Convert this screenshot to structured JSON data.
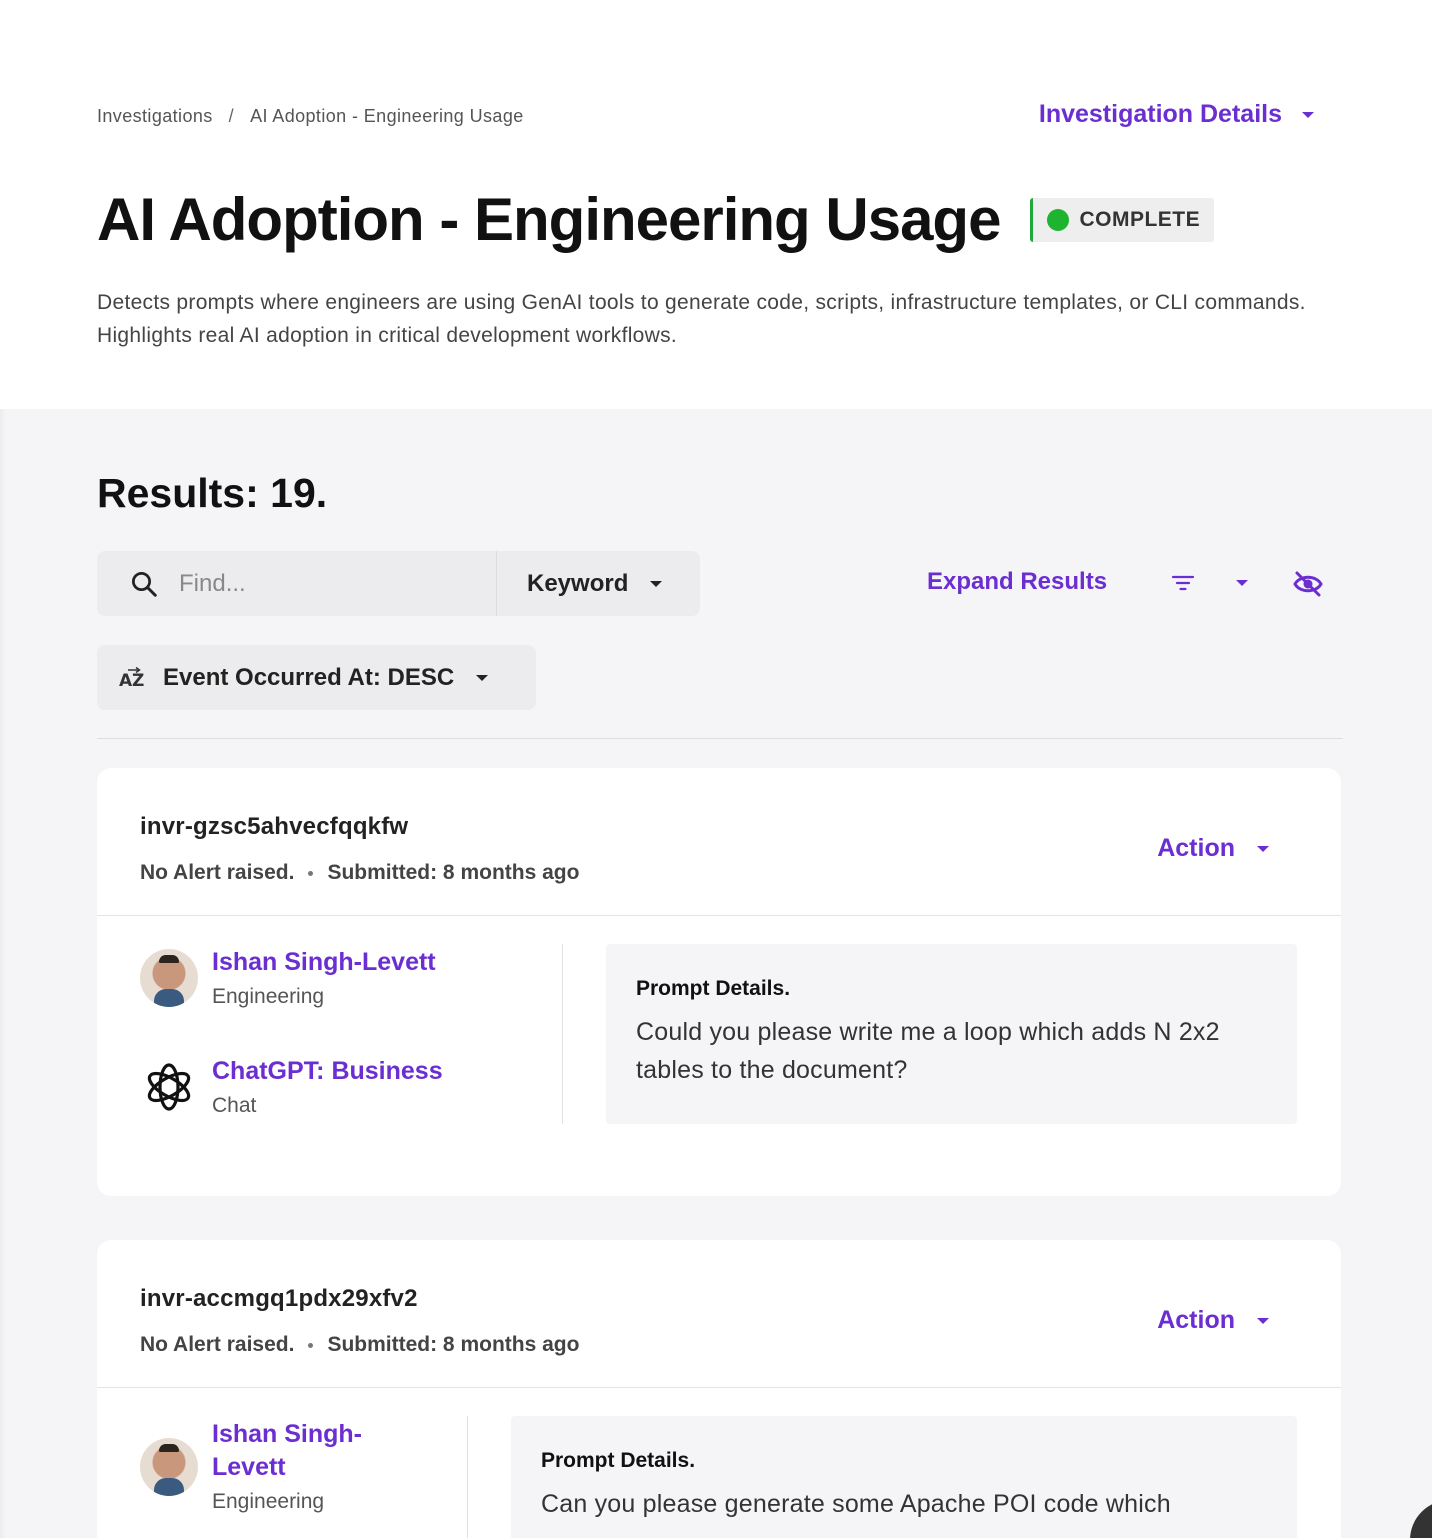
{
  "breadcrumb": {
    "root": "Investigations",
    "separator": "/",
    "current": "AI Adoption - Engineering Usage"
  },
  "header": {
    "details_label": "Investigation Details",
    "title": "AI Adoption - Engineering Usage",
    "status": "COMPLETE",
    "status_color": "#1fb42f",
    "description": "Detects prompts where engineers are using GenAI tools to generate code, scripts, infrastructure templates, or CLI commands. Highlights real AI adoption in critical development workflows."
  },
  "results": {
    "count_label": "Results: 19.",
    "search_placeholder": "Find...",
    "search_mode": "Keyword",
    "expand_label": "Expand Results",
    "sort_label": "Event Occurred At: DESC",
    "sort_icon": "az-sort-icon"
  },
  "accent_color": "#6b2fd1",
  "cards": [
    {
      "id": "invr-gzsc5ahvecfqqkfw",
      "alert": "No Alert raised.",
      "submitted": "Submitted: 8 months ago",
      "action_label": "Action",
      "user_name": "Ishan Singh-Levett",
      "user_dept": "Engineering",
      "app_name": "ChatGPT: Business",
      "app_type": "Chat",
      "prompt_label": "Prompt Details.",
      "prompt_text": "Could you please write me a loop which adds N 2x2 tables to the document?"
    },
    {
      "id": "invr-accmgq1pdx29xfv2",
      "alert": "No Alert raised.",
      "submitted": "Submitted: 8 months ago",
      "action_label": "Action",
      "user_name": "Ishan Singh-Levett",
      "user_dept": "Engineering",
      "prompt_label": "Prompt Details.",
      "prompt_text": "Can you please generate some Apache POI code which"
    }
  ]
}
